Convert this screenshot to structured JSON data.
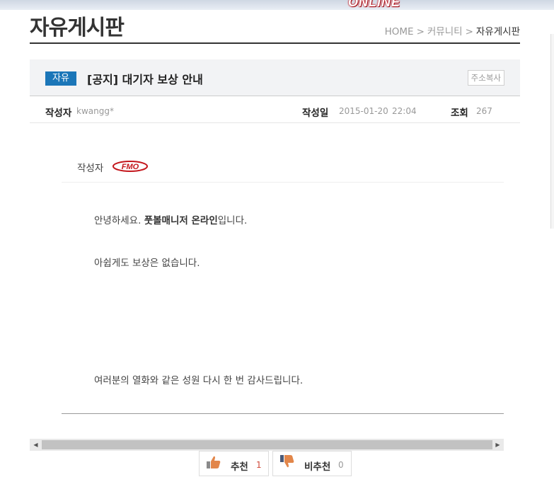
{
  "banner": {
    "logo_text": "ONLINE"
  },
  "board": {
    "title": "자유게시판"
  },
  "breadcrumb": {
    "home": "HOME",
    "section": "커뮤니티",
    "current": "자유게시판",
    "separator": ">"
  },
  "post": {
    "category": "자유",
    "title": "[공지] 대기자 보상 안내",
    "copy_button": "주소복사",
    "meta": {
      "author_label": "작성자",
      "author": "kwangg*",
      "date_label": "작성일",
      "date": "2015-01-20",
      "time": "22:04",
      "views_label": "조회",
      "views": "267"
    },
    "author_box": {
      "label": "작성자",
      "logo_text": "FMO"
    },
    "body": {
      "line1_before": "안녕하세요. ",
      "line1_bold": "풋볼매니저 온라인",
      "line1_after": "입니다.",
      "line2": "아쉽게도 보상은 없습니다.",
      "line3": "여러분의 열화와 같은 성원 다시 한 번 감사드립니다."
    }
  },
  "votes": {
    "like_label": "추천",
    "like_count": "1",
    "dislike_label": "비추천",
    "dislike_count": "0"
  },
  "colors": {
    "badge": "#1b76b8",
    "count_red": "#d04a3a",
    "rule": "#333333"
  }
}
